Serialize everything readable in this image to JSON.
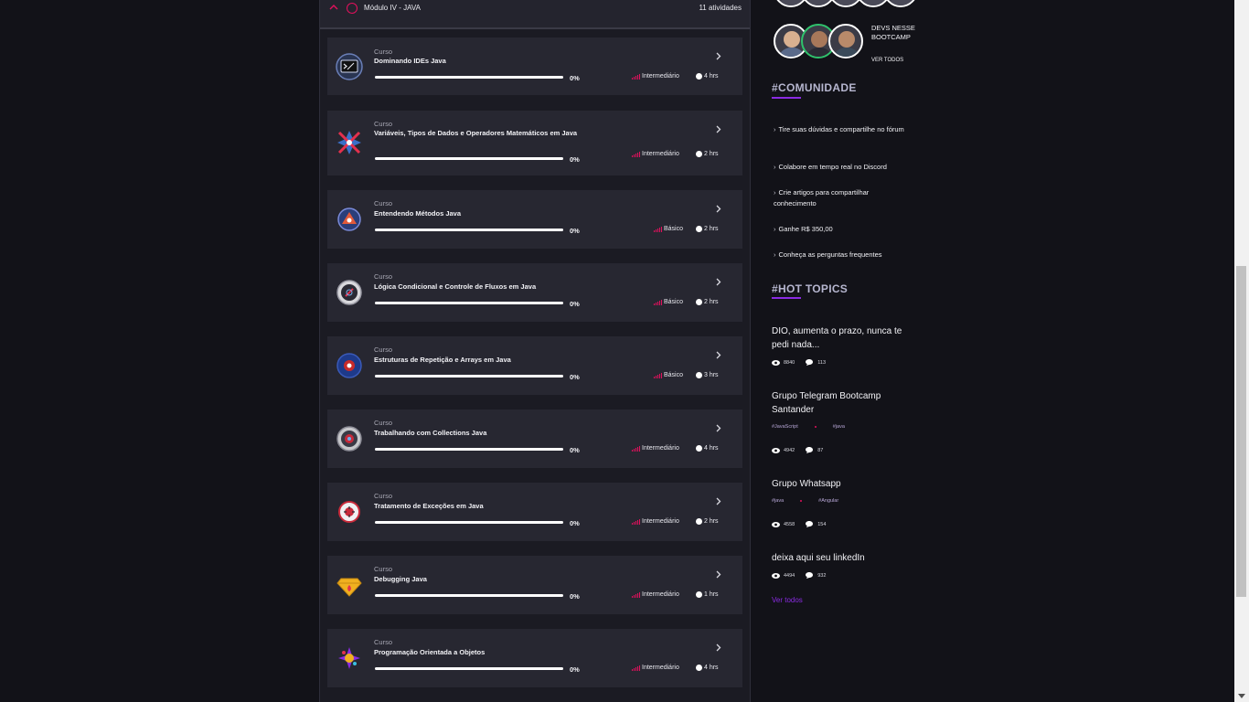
{
  "module": {
    "title": "Módulo IV - JAVA",
    "count": "11 atividades"
  },
  "courses": [
    {
      "kind": "Curso",
      "title": "Dominando IDEs Java",
      "progress": 0,
      "pct": "0%",
      "level": "Intermediário",
      "hours": "4 hrs",
      "icon": "ide-terminal-icon"
    },
    {
      "kind": "Curso",
      "title": "Variáveis, Tipos de Dados e Operadores Matemáticos em Java",
      "progress": 0,
      "pct": "0%",
      "level": "Intermediário",
      "hours": "2 hrs",
      "icon": "variables-icon"
    },
    {
      "kind": "Curso",
      "title": "Entendendo Métodos Java",
      "progress": 0,
      "pct": "0%",
      "level": "Básico",
      "hours": "2 hrs",
      "icon": "methods-icon"
    },
    {
      "kind": "Curso",
      "title": "Lógica Condicional e Controle de Fluxos em Java",
      "progress": 0,
      "pct": "0%",
      "level": "Básico",
      "hours": "2 hrs",
      "icon": "conditional-logic-icon"
    },
    {
      "kind": "Curso",
      "title": "Estruturas de Repetição e Arrays em Java",
      "progress": 0,
      "pct": "0%",
      "level": "Básico",
      "hours": "3 hrs",
      "icon": "loops-arrays-icon"
    },
    {
      "kind": "Curso",
      "title": "Trabalhando com Collections Java",
      "progress": 0,
      "pct": "0%",
      "level": "Intermediário",
      "hours": "4 hrs",
      "icon": "collections-icon"
    },
    {
      "kind": "Curso",
      "title": "Tratamento de Exceções em Java",
      "progress": 0,
      "pct": "0%",
      "level": "Intermediário",
      "hours": "2 hrs",
      "icon": "exceptions-icon"
    },
    {
      "kind": "Curso",
      "title": "Debugging Java",
      "progress": 0,
      "pct": "0%",
      "level": "Intermediário",
      "hours": "1 hrs",
      "icon": "debugging-icon"
    },
    {
      "kind": "Curso",
      "title": "Programação Orientada a Objetos",
      "progress": 0,
      "pct": "0%",
      "level": "Intermediário",
      "hours": "4 hrs",
      "icon": "oop-icon"
    }
  ],
  "sidebar": {
    "devs_label": "DEVS NESSE BOOTCAMP",
    "devs_link": "VER TODOS",
    "community": {
      "title": "#COMUNIDADE",
      "links": [
        "Tire suas dúvidas e compartilhe no fórum",
        "Colabore em tempo real no Discord",
        "Crie artigos para compartilhar conhecimento",
        "Ganhe R$ 350,00",
        "Conheça as perguntas frequentes"
      ]
    },
    "hot_topics": {
      "title": "#HOT TOPICS",
      "topics": [
        {
          "title": "DIO, aumenta o prazo, nunca te pedi nada...",
          "tags": [],
          "views": "8840",
          "comments": "113"
        },
        {
          "title": "Grupo Telegram Bootcamp Santander",
          "tags": [
            "#JavaScript",
            "#java"
          ],
          "views": "4942",
          "comments": "87"
        },
        {
          "title": "Grupo Whatsapp",
          "tags": [
            "#java",
            "#Angular"
          ],
          "views": "4558",
          "comments": "154"
        },
        {
          "title": "deixa aqui seu linkedIn",
          "tags": [],
          "views": "4494",
          "comments": "932"
        }
      ],
      "see_all": "Ver todos"
    }
  },
  "colors": {
    "accent_pink": "#e4105d",
    "accent_purple": "#8a2be2",
    "avatar_online": "#2fc26c"
  }
}
